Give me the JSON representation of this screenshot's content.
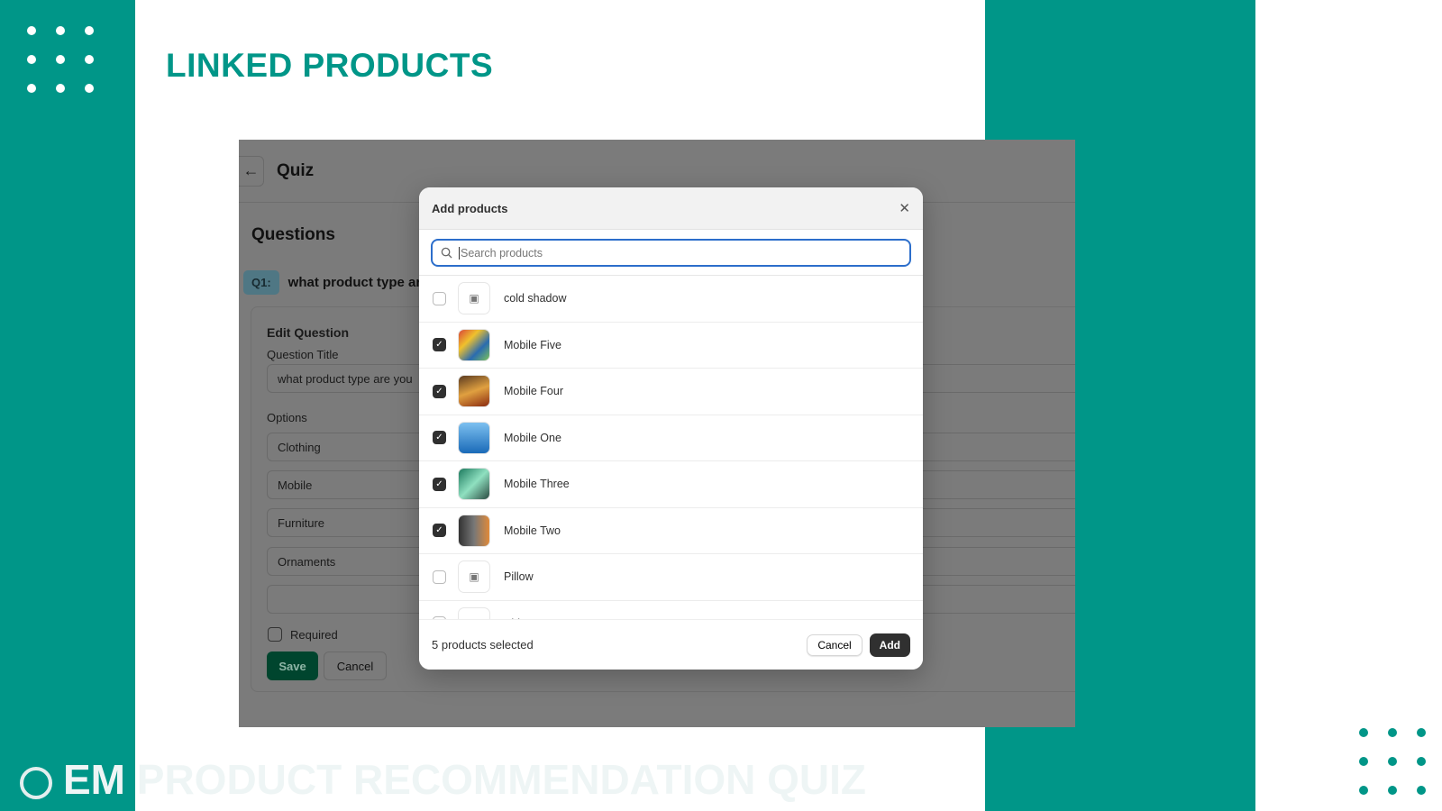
{
  "page_title": "LINKED PRODUCTS",
  "watermark": "EM PRODUCT RECOMMENDATION QUIZ",
  "colors": {
    "brand": "#009688",
    "dots_light": "#ffffff",
    "dots_dark": "#009688"
  },
  "app": {
    "title": "Quiz",
    "section": "Questions",
    "question_tag": "Q1:",
    "question_text": "what product type are",
    "edit_heading": "Edit Question",
    "question_title_label": "Question Title",
    "question_title_value": "what product type are you",
    "options_label": "Options",
    "options": [
      "Clothing",
      "Mobile",
      "Furniture",
      "Ornaments",
      ""
    ],
    "required_label": "Required",
    "save_label": "Save",
    "cancel_label": "Cancel"
  },
  "modal": {
    "title": "Add products",
    "search_placeholder": "Search products",
    "products": [
      {
        "name": "cold shadow",
        "checked": false,
        "image": "placeholder"
      },
      {
        "name": "Mobile Five",
        "checked": true,
        "image": "photo"
      },
      {
        "name": "Mobile Four",
        "checked": true,
        "image": "photo"
      },
      {
        "name": "Mobile One",
        "checked": true,
        "image": "photo"
      },
      {
        "name": "Mobile Three",
        "checked": true,
        "image": "photo"
      },
      {
        "name": "Mobile Two",
        "checked": true,
        "image": "photo"
      },
      {
        "name": "Pillow",
        "checked": false,
        "image": "placeholder"
      },
      {
        "name": "Shirt",
        "checked": false,
        "image": "placeholder"
      }
    ],
    "selected_text": "5 products selected",
    "cancel_label": "Cancel",
    "add_label": "Add"
  }
}
